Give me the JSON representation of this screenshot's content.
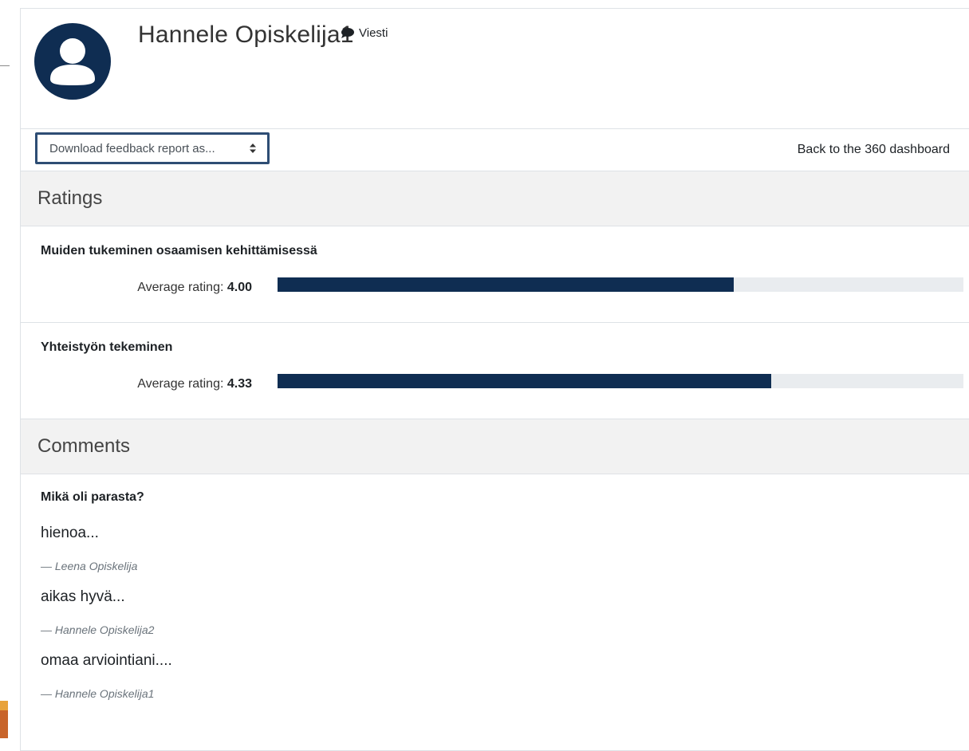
{
  "user": {
    "name": "Hannele Opiskelija1",
    "message_label": "Viesti"
  },
  "toolbar": {
    "download_select": "Download feedback report as...",
    "back_link": "Back to the 360 dashboard"
  },
  "ratings": {
    "heading": "Ratings",
    "items": [
      {
        "title": "Muiden tukeminen osaamisen kehittämisessä",
        "label": "Average rating:",
        "value": "4.00",
        "fill_fraction": 0.665
      },
      {
        "title": "Yhteistyön tekeminen",
        "label": "Average rating:",
        "value": "4.33",
        "fill_fraction": 0.72
      }
    ]
  },
  "comments": {
    "heading": "Comments",
    "question": "Mikä oli parasta?",
    "items": [
      {
        "text": "hienoa...",
        "author": "— Leena Opiskelija"
      },
      {
        "text": "aikas hyvä...",
        "author": "— Hannele Opiskelija2"
      },
      {
        "text": "omaa arviointiani....",
        "author": "— Hannele Opiskelija1"
      }
    ]
  },
  "colors": {
    "bar_fill": "#0f2d52",
    "bar_track": "#e9ecef",
    "avatar": "#0f2d52",
    "select_border": "#2e4d74"
  },
  "icons": {
    "avatar": "user-avatar-icon",
    "message": "speech-bubble-icon",
    "select": "updown-caret-icon"
  }
}
